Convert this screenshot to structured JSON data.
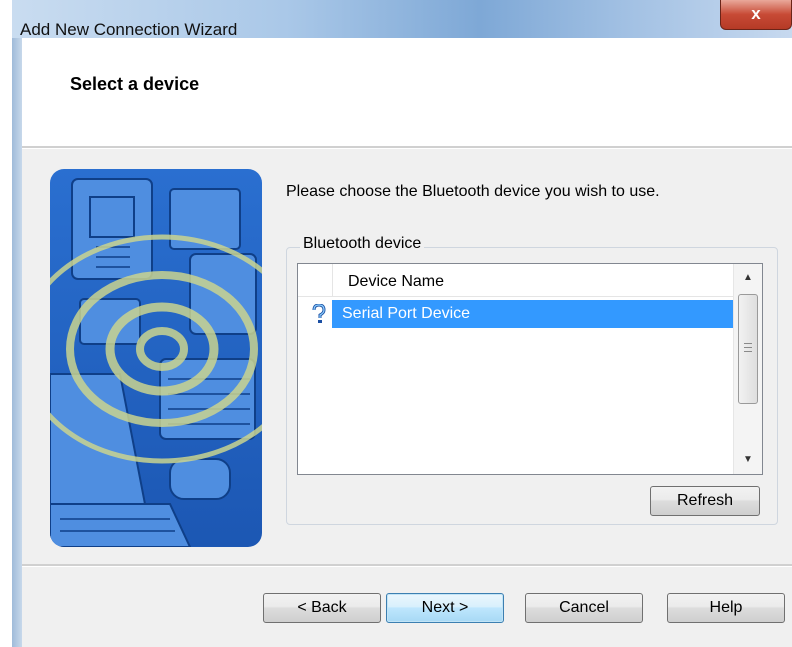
{
  "window": {
    "title": "Add New Connection Wizard",
    "close_glyph": "x"
  },
  "header": {
    "title": "Select a device"
  },
  "main": {
    "prompt": "Please choose the Bluetooth device you wish to use.",
    "group_label": "Bluetooth device",
    "list": {
      "column_header": "Device Name",
      "rows": [
        {
          "name": "Serial Port Device",
          "icon": "bluetooth-unknown-device-icon",
          "selected": true
        }
      ]
    },
    "refresh_label": "Refresh"
  },
  "footer": {
    "back_label": "< Back",
    "next_label": "Next >",
    "cancel_label": "Cancel",
    "help_label": "Help"
  },
  "colors": {
    "selection": "#3399ff",
    "banner_blue": "#1f66c9"
  }
}
